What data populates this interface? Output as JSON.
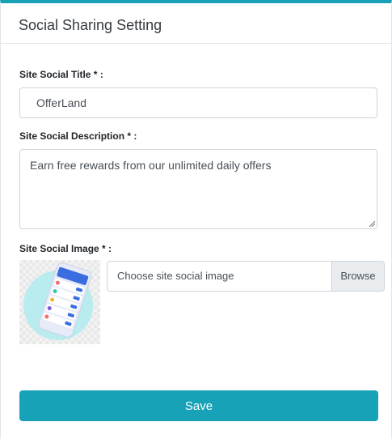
{
  "header": {
    "title": "Social Sharing Setting"
  },
  "form": {
    "title_label": "Site Social Title * :",
    "title_value": "OfferLand",
    "description_label": "Site Social Description * :",
    "description_value": "Earn free rewards from our unlimited daily offers",
    "image_label": "Site Social Image * :",
    "file_placeholder": "Choose site social image",
    "browse_label": "Browse",
    "save_label": "Save"
  },
  "colors": {
    "accent": "#17a2b8",
    "border": "#ced4da"
  }
}
